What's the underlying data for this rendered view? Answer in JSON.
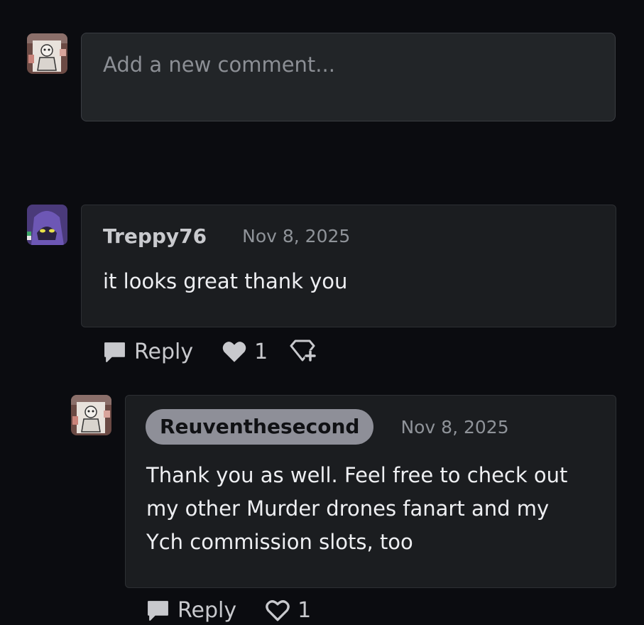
{
  "new_comment": {
    "placeholder": "Add a new comment..."
  },
  "comments": [
    {
      "username": "Treppy76",
      "date": "Nov 8, 2025",
      "text": "it looks great thank you",
      "reply_label": "Reply",
      "like_count": "1",
      "avatar_icon": "hooded-purple-character-avatar"
    },
    {
      "username": "Reuventhesecond",
      "date": "Nov 8, 2025",
      "text_lines": [
        "Thank you as well. Feel free to check out",
        "my other Murder drones fanart and my",
        "Ych commission slots, too"
      ],
      "reply_label": "Reply",
      "like_count": "1",
      "avatar_icon": "artwork-thumbnail-avatar"
    }
  ],
  "colors": {
    "background": "#0b0c10",
    "comment_bg": "#1b1d20",
    "input_bg": "#222528",
    "author_pill": "#8e8f98"
  }
}
